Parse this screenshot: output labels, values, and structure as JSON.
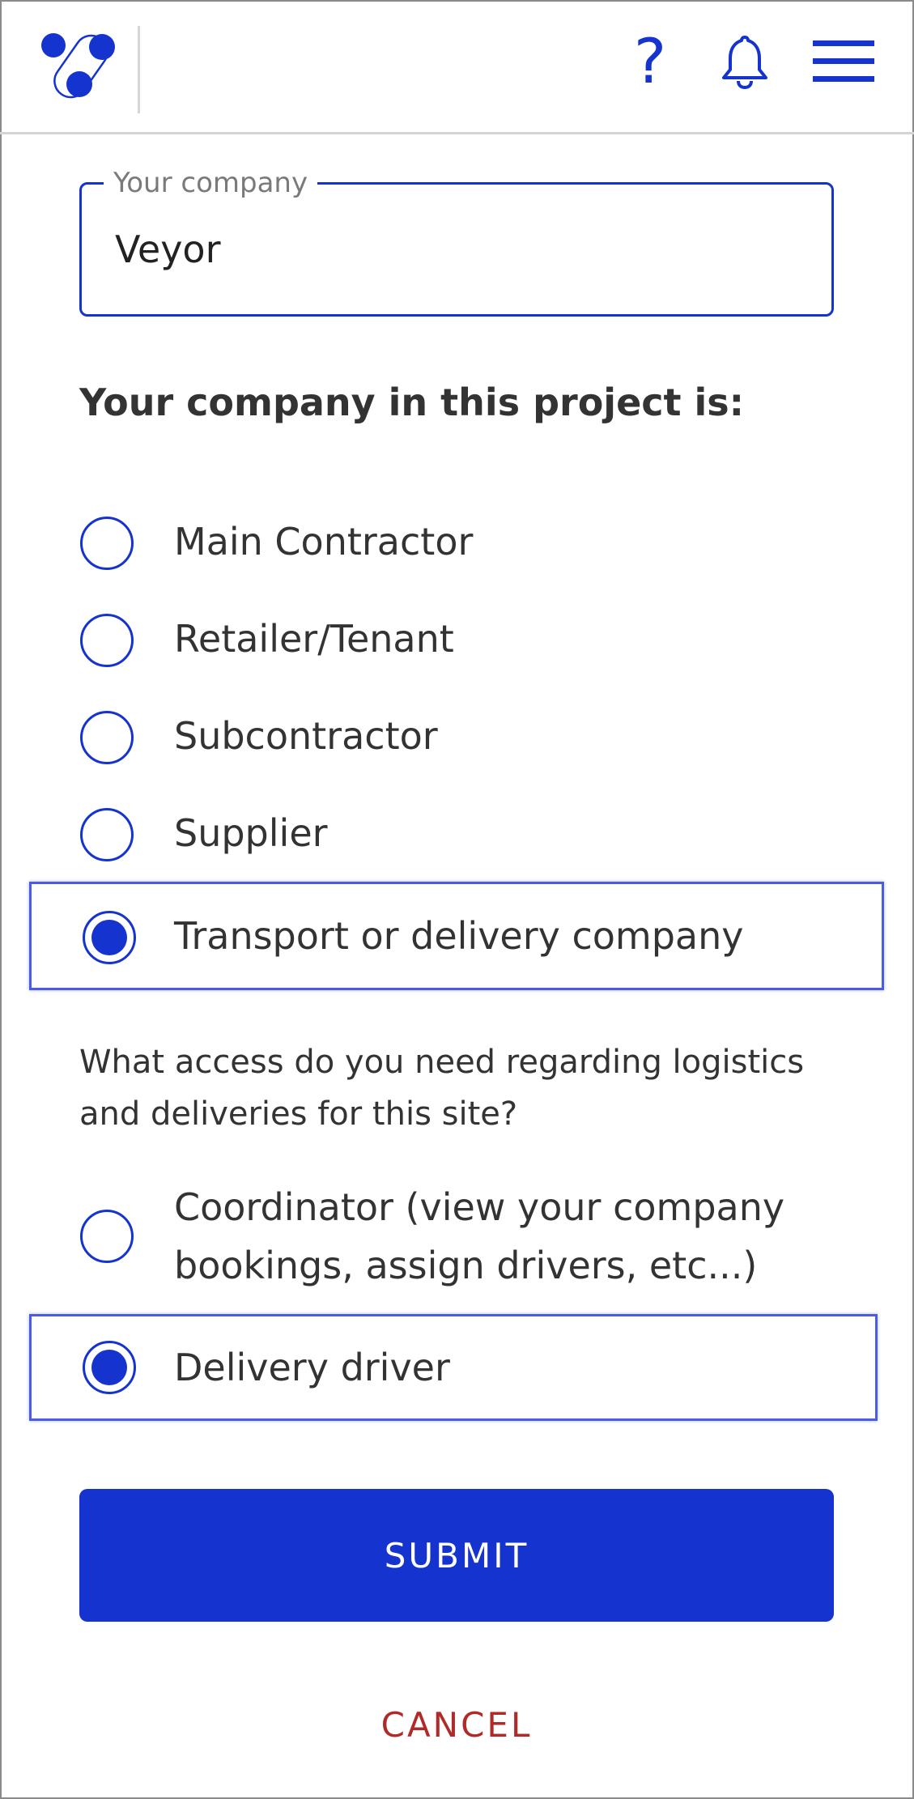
{
  "colors": {
    "accent": "#1533cf",
    "cancel": "#b02a2a",
    "text": "#333333",
    "muted": "#7a7a7a"
  },
  "header": {
    "logo_icon": "brand-logo-icon",
    "help_icon": "question-mark-icon",
    "help_glyph": "?",
    "notifications_icon": "bell-icon",
    "menu_icon": "hamburger-menu-icon"
  },
  "company": {
    "label": "Your company",
    "value": "Veyor"
  },
  "role_section": {
    "heading": "Your company in this project is:",
    "options": [
      {
        "label": "Main Contractor",
        "selected": false
      },
      {
        "label": "Retailer/Tenant",
        "selected": false
      },
      {
        "label": "Subcontractor",
        "selected": false
      },
      {
        "label": "Supplier",
        "selected": false
      },
      {
        "label": "Transport or delivery company",
        "selected": true
      }
    ]
  },
  "access_section": {
    "question": "What access do you need regarding logistics and deliveries for this site?",
    "options": [
      {
        "label": "Coordinator (view your company bookings, assign drivers, etc...)",
        "selected": false
      },
      {
        "label": "Delivery driver",
        "selected": true
      }
    ]
  },
  "actions": {
    "submit_label": "SUBMIT",
    "cancel_label": "CANCEL"
  }
}
